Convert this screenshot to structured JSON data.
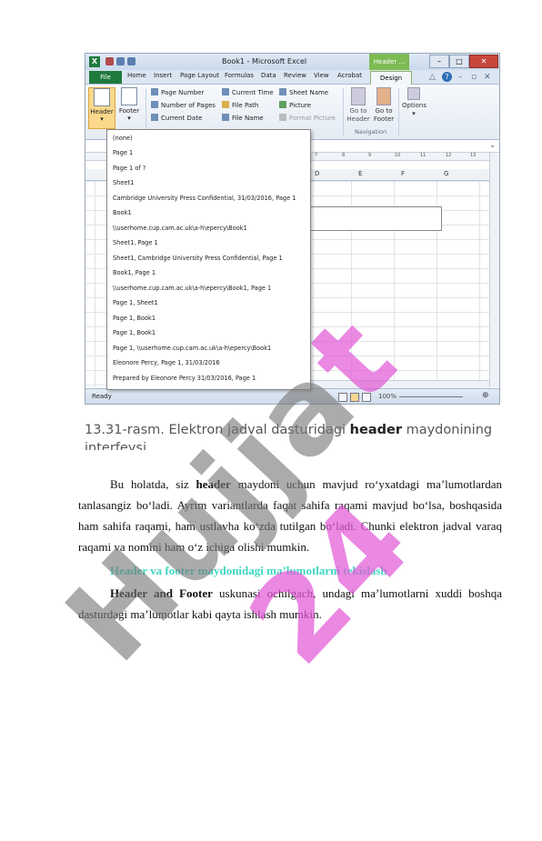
{
  "excel": {
    "window_title": "Book1 - Microsoft Excel",
    "context_tab_title": "Header ...",
    "tabs": [
      "File",
      "Home",
      "Insert",
      "Page Layout",
      "Formulas",
      "Data",
      "Review",
      "View",
      "Acrobat",
      "Design"
    ],
    "ribbon": {
      "header_label": "Header",
      "footer_label": "Footer",
      "page_number": "Page Number",
      "number_of_pages": "Number of Pages",
      "current_date": "Current Date",
      "current_time": "Current Time",
      "file_path": "File Path",
      "file_name": "File Name",
      "sheet_name": "Sheet Name",
      "picture": "Picture",
      "format_picture": "Format Picture",
      "go_to_header": "Go to Header",
      "go_to_footer": "Go to Footer",
      "options": "Options",
      "navigation_group": "Navigation"
    },
    "header_options": [
      "(none)",
      "Page 1",
      "Page 1 of ?",
      "Sheet1",
      "Cambridge University Press Confidential, 31/03/2016, Page 1",
      "Book1",
      "\\\\userhome.cup.cam.ac.uk\\a-h\\epercy\\Book1",
      "Sheet1, Page 1",
      "Sheet1, Cambridge University Press Confidential, Page 1",
      "Book1, Page 1",
      "\\\\userhome.cup.cam.ac.uk\\a-h\\epercy\\Book1, Page 1",
      "Page 1, Sheet1",
      "Page 1, Book1",
      "Page 1, Book1",
      "Page 1, \\\\userhome.cup.cam.ac.uk\\a-h\\epercy\\Book1",
      "Eleonore Percy, Page 1, 31/03/2016",
      "Prepared by Eleonore Percy 31/03/2016, Page 1"
    ],
    "columns": [
      "D",
      "E",
      "F",
      "G"
    ],
    "ruler_marks": [
      "7",
      "8",
      "9",
      "10",
      "11",
      "12",
      "13"
    ],
    "status_ready": "Ready",
    "zoom": "100%"
  },
  "caption": {
    "prefix": "13.31-rasm. Elektron jadval dasturidagi ",
    "bold": "header",
    "suffix": " maydonining interfeysi"
  },
  "paragraphs": {
    "p1_before": "Bu holatda, siz ",
    "p1_bold": "header",
    "p1_after": " maydoni uchun mavjud ro‘yxatdagi ma’lumotlardan tanlasangiz bo‘ladi. Ayrim variantlarda faqat sahifa raqami mavjud bo‘lsa, boshqasida ham sahifa raqami, ham ustlavha ko‘zda tutilgan bo‘ladi. Chunki elektron jadval varaq raqami va nomini ham o‘z ichiga olishi mumkin.",
    "heading": "Header va footer maydonidagi ma’lumotlarni tekislash",
    "p2_bold": "Header and Footer",
    "p2_after": " uskunasi ochilgach, undagi ma’lumotlarni xuddi boshqa dasturdagi ma’lumotlar kabi qayta ishlash mumkin."
  },
  "watermark": {
    "part1": "Hujja",
    "part2": "t 24"
  }
}
